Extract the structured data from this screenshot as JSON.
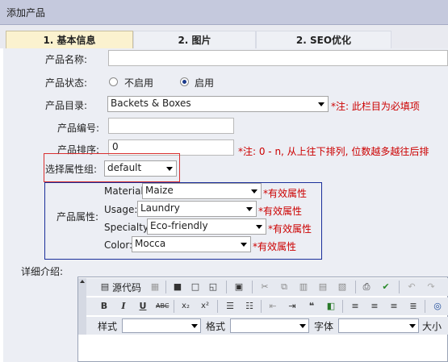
{
  "title": "添加产品",
  "tabs": [
    "1. 基本信息",
    "2. 图片",
    "2. SEO优化"
  ],
  "form": {
    "name_label": "产品名称:",
    "status_label": "产品状态:",
    "status_off": "不启用",
    "status_on": "启用",
    "category_label": "产品目录:",
    "category_value": "Backets & Boxes",
    "category_note": "*注:  此栏目为必填项",
    "code_label": "产品编号:",
    "sort_label": "产品排序:",
    "sort_value": "0",
    "sort_note": "*注: 0 - n, 从上往下排列, 位数越多越往后排",
    "attrgroup_label": "选择属性组:",
    "attrgroup_value": "default",
    "attr_label": "产品属性:",
    "attributes": [
      {
        "name": "Material:",
        "value": "Maize",
        "note": "*有效属性"
      },
      {
        "name": "Usage:",
        "value": "Laundry",
        "note": "*有效属性"
      },
      {
        "name": "Specialty:",
        "value": "Eco-friendly",
        "note": "*有效属性"
      },
      {
        "name": "Color:",
        "value": "Mocca",
        "note": "*有效属性"
      }
    ],
    "detail_label": "详细介绍:"
  },
  "editor": {
    "source_label": "源代码",
    "style_label": "样式",
    "format_label": "格式",
    "font_label": "字体",
    "size_label": "大小",
    "toolbar_row1_icons": [
      "source-icon",
      "paste-icon",
      "save-icon",
      "new-page-icon",
      "preview-icon",
      "template-icon",
      "cut-icon",
      "copy-icon",
      "paste-icon",
      "paste-text-icon",
      "paste-word-icon",
      "print-icon",
      "spellcheck-icon",
      "undo-icon",
      "redo-icon"
    ],
    "toolbar_row2_icons": [
      "bold-icon",
      "italic-icon",
      "underline-icon",
      "strike-icon",
      "subscript-icon",
      "superscript-icon",
      "ordered-list-icon",
      "unordered-list-icon",
      "outdent-icon",
      "indent-icon",
      "blockquote-icon",
      "div-icon",
      "align-left-icon",
      "align-center-icon",
      "align-right-icon",
      "justify-icon",
      "link-icon"
    ]
  }
}
